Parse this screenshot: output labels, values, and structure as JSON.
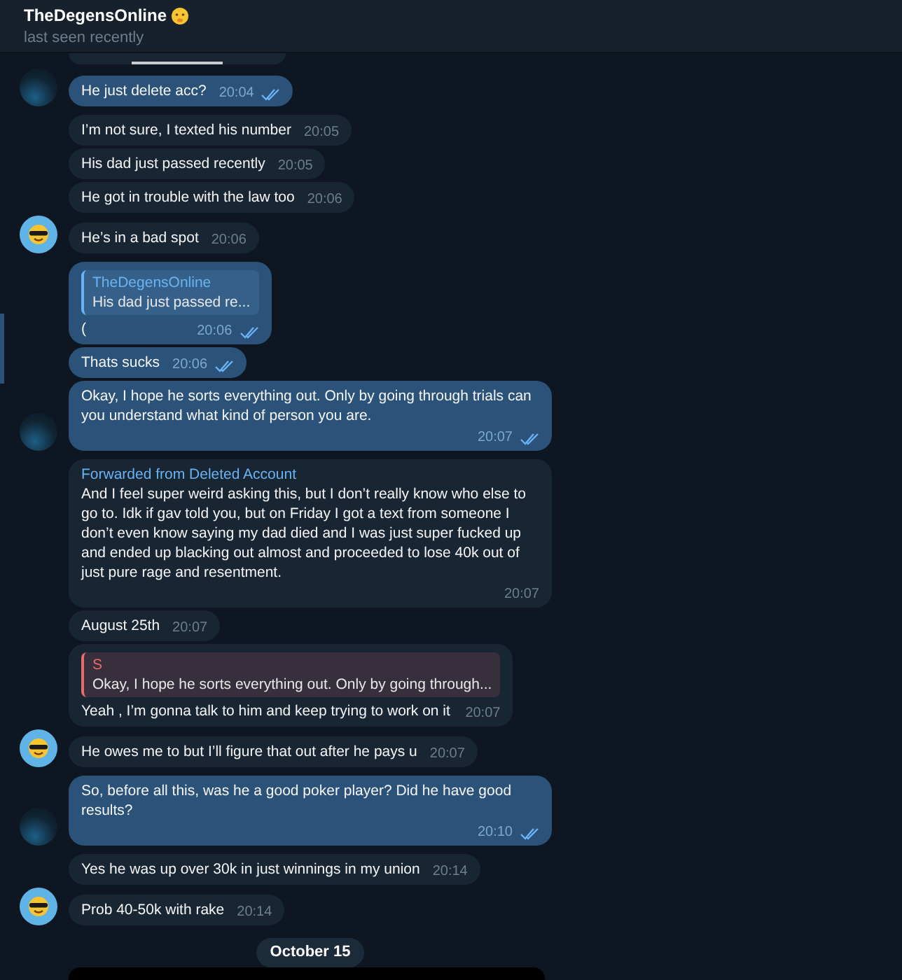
{
  "header": {
    "title": "TheDegensOnline",
    "status": "last seen recently"
  },
  "messages": [
    {
      "outgoing": true,
      "text": "He just delete acc?",
      "time": "20:04",
      "read": true,
      "avatar": {
        "kind": "photo"
      }
    },
    {
      "outgoing": false,
      "text": "I’m not sure, I texted his number",
      "time": "20:05"
    },
    {
      "outgoing": false,
      "text": "His dad just passed recently",
      "time": "20:05"
    },
    {
      "outgoing": false,
      "text": "He got in trouble with the law too",
      "time": "20:06"
    },
    {
      "outgoing": false,
      "text": "He’s in a bad spot",
      "time": "20:06",
      "avatar": {
        "kind": "emoji"
      }
    },
    {
      "outgoing": true,
      "reply": {
        "author": "TheDegensOnline",
        "text": "His dad just passed re...",
        "color": "#6ab3f3"
      },
      "text": "(",
      "time": "20:06",
      "read": true
    },
    {
      "outgoing": true,
      "text": "Thats sucks",
      "time": "20:06",
      "read": true
    },
    {
      "outgoing": true,
      "text": "Okay, I hope he sorts everything out. Only by going through trials can you understand what kind of person you are.",
      "time": "20:07",
      "read": true,
      "avatar": {
        "kind": "photo"
      }
    },
    {
      "outgoing": false,
      "forwarded": "Forwarded from Deleted Account",
      "text": "And I feel super weird asking this, but I don’t really know who else to go to. Idk if gav told you, but on Friday I got a text from someone I don’t even know saying my dad died and I was just super fucked up and ended up blacking out almost and proceeded to lose 40k out of just pure rage and resentment.",
      "time": "20:07"
    },
    {
      "outgoing": false,
      "text": "August 25th",
      "time": "20:07"
    },
    {
      "outgoing": false,
      "reply": {
        "author": "S",
        "text": "Okay, I hope he sorts everything out. Only by going through...",
        "color": "#e86c6c"
      },
      "text": "Yeah , I’m gonna talk to him and keep trying to work on it",
      "time": "20:07"
    },
    {
      "outgoing": false,
      "text": "He owes me to but I’ll figure that out after he pays u",
      "time": "20:07",
      "avatar": {
        "kind": "emoji"
      }
    },
    {
      "outgoing": true,
      "text": "So, before all this, was he a good poker player? Did he have good results?",
      "time": "20:10",
      "read": true,
      "avatar": {
        "kind": "photo"
      }
    },
    {
      "outgoing": false,
      "text": "Yes he was up over 30k in just winnings in my union",
      "time": "20:14"
    },
    {
      "outgoing": false,
      "text": "Prob 40-50k with rake",
      "time": "20:14",
      "avatar": {
        "kind": "emoji"
      }
    }
  ],
  "date_separator": "October 15"
}
